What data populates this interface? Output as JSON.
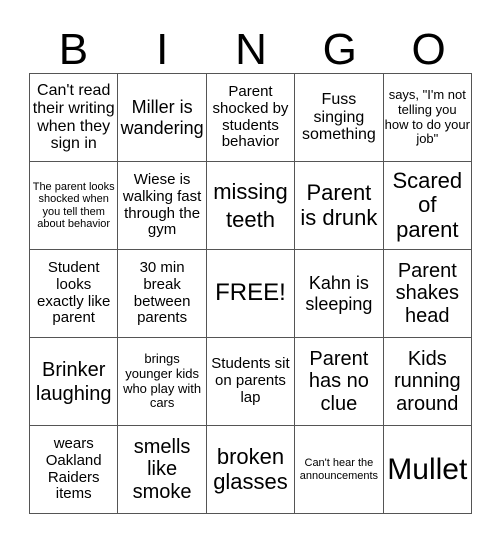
{
  "header": {
    "letters": [
      "B",
      "I",
      "N",
      "G",
      "O"
    ]
  },
  "cells": [
    "Can't read their writing when they sign in",
    "Miller is wandering",
    "Parent shocked by students behavior",
    "Fuss singing something",
    "says, \"I'm not telling you how to do your job\"",
    "The parent looks shocked when you tell them about behavior",
    "Wiese is walking fast through the gym",
    "missing teeth",
    "Parent is drunk",
    "Scared of parent",
    "Student looks exactly like parent",
    "30 min break between parents",
    "FREE!",
    "Kahn is sleeping",
    "Parent shakes head",
    "Brinker laughing",
    "brings younger kids who play with cars",
    "Students sit on parents lap",
    "Parent has no clue",
    "Kids running around",
    "wears Oakland Raiders items",
    "smells like smoke",
    "broken glasses",
    "Can't hear the announcements",
    "Mullet"
  ]
}
